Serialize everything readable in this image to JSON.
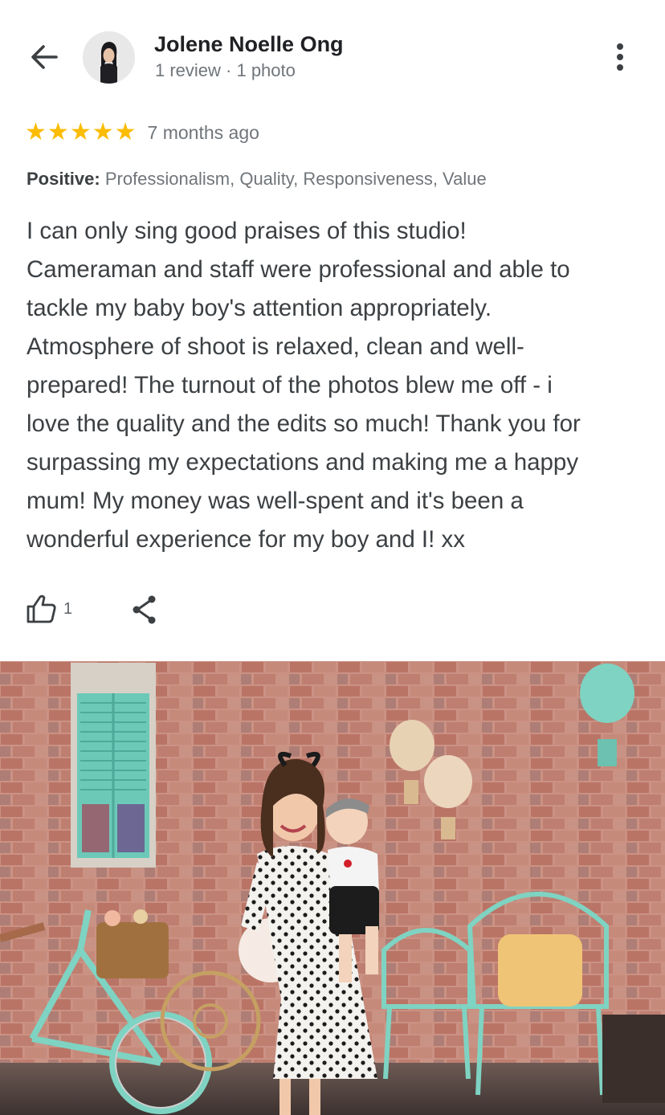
{
  "header": {
    "back_icon": "arrow-back-icon",
    "user_name": "Jolene Noelle Ong",
    "user_meta": "1 review · 1 photo",
    "more_icon": "more-vert-icon"
  },
  "review": {
    "rating": 5,
    "max_rating": 5,
    "time": "7 months ago",
    "positive_label": "Positive:",
    "positive_items": "Professionalism, Quality, Responsiveness, Value",
    "lines": [
      "I can only sing good praises of this studio!",
      "Cameraman and staff were professional and able to",
      "tackle my baby boy's attention appropriately.",
      "Atmosphere of shoot is relaxed, clean and well-",
      "prepared! The turnout of the photos blew me off - i",
      "love the quality and the edits so much! Thank you for",
      "surpassing my expectations and making me a happy",
      "mum! My money was well-spent and it's been a",
      "wonderful experience for my boy and I! xx"
    ]
  },
  "actions": {
    "like_icon": "thumb-up-icon",
    "like_count": "1",
    "share_icon": "share-icon"
  },
  "colors": {
    "star": "#fbbc04",
    "text_primary": "#202124",
    "text_secondary": "#70757a",
    "brick": "#b5695a",
    "mint": "#7fd3c2"
  }
}
